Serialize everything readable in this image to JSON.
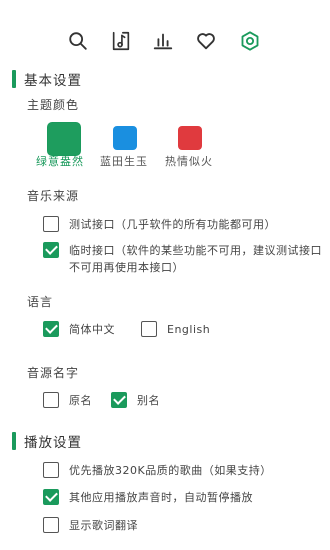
{
  "colors": {
    "accent": "#1a9a5c",
    "green": "#1e9d5e",
    "blue": "#1a8fe0",
    "red": "#e03a3e"
  },
  "toolbar": {
    "icons": [
      "search-icon",
      "music-note-icon",
      "chart-icon",
      "heart-icon",
      "settings-gear-icon"
    ],
    "active": "settings-gear-icon"
  },
  "basic": {
    "title": "基本设置",
    "theme": {
      "label": "主题颜色",
      "options": [
        {
          "name": "绿意盎然",
          "color": "#1e9d5e",
          "selected": true
        },
        {
          "name": "蓝田生玉",
          "color": "#1a8fe0",
          "selected": false
        },
        {
          "name": "热情似火",
          "color": "#e03a3e",
          "selected": false
        }
      ]
    },
    "source": {
      "label": "音乐来源",
      "options": [
        {
          "label": "测试接口（几乎软件的所有功能都可用）",
          "checked": false
        },
        {
          "label": "临时接口（软件的某些功能不可用，建议测试接口不可用再使用本接口）",
          "checked": true
        }
      ]
    },
    "language": {
      "label": "语言",
      "options": [
        {
          "label": "简体中文",
          "checked": true
        },
        {
          "label": "English",
          "checked": false
        }
      ]
    },
    "naming": {
      "label": "音源名字",
      "options": [
        {
          "label": "原名",
          "checked": false
        },
        {
          "label": "别名",
          "checked": true
        }
      ]
    }
  },
  "playback": {
    "title": "播放设置",
    "options": [
      {
        "label": "优先播放320K品质的歌曲（如果支持）",
        "checked": false
      },
      {
        "label": "其他应用播放声音时，自动暂停播放",
        "checked": true
      },
      {
        "label": "显示歌词翻译",
        "checked": false
      }
    ]
  }
}
